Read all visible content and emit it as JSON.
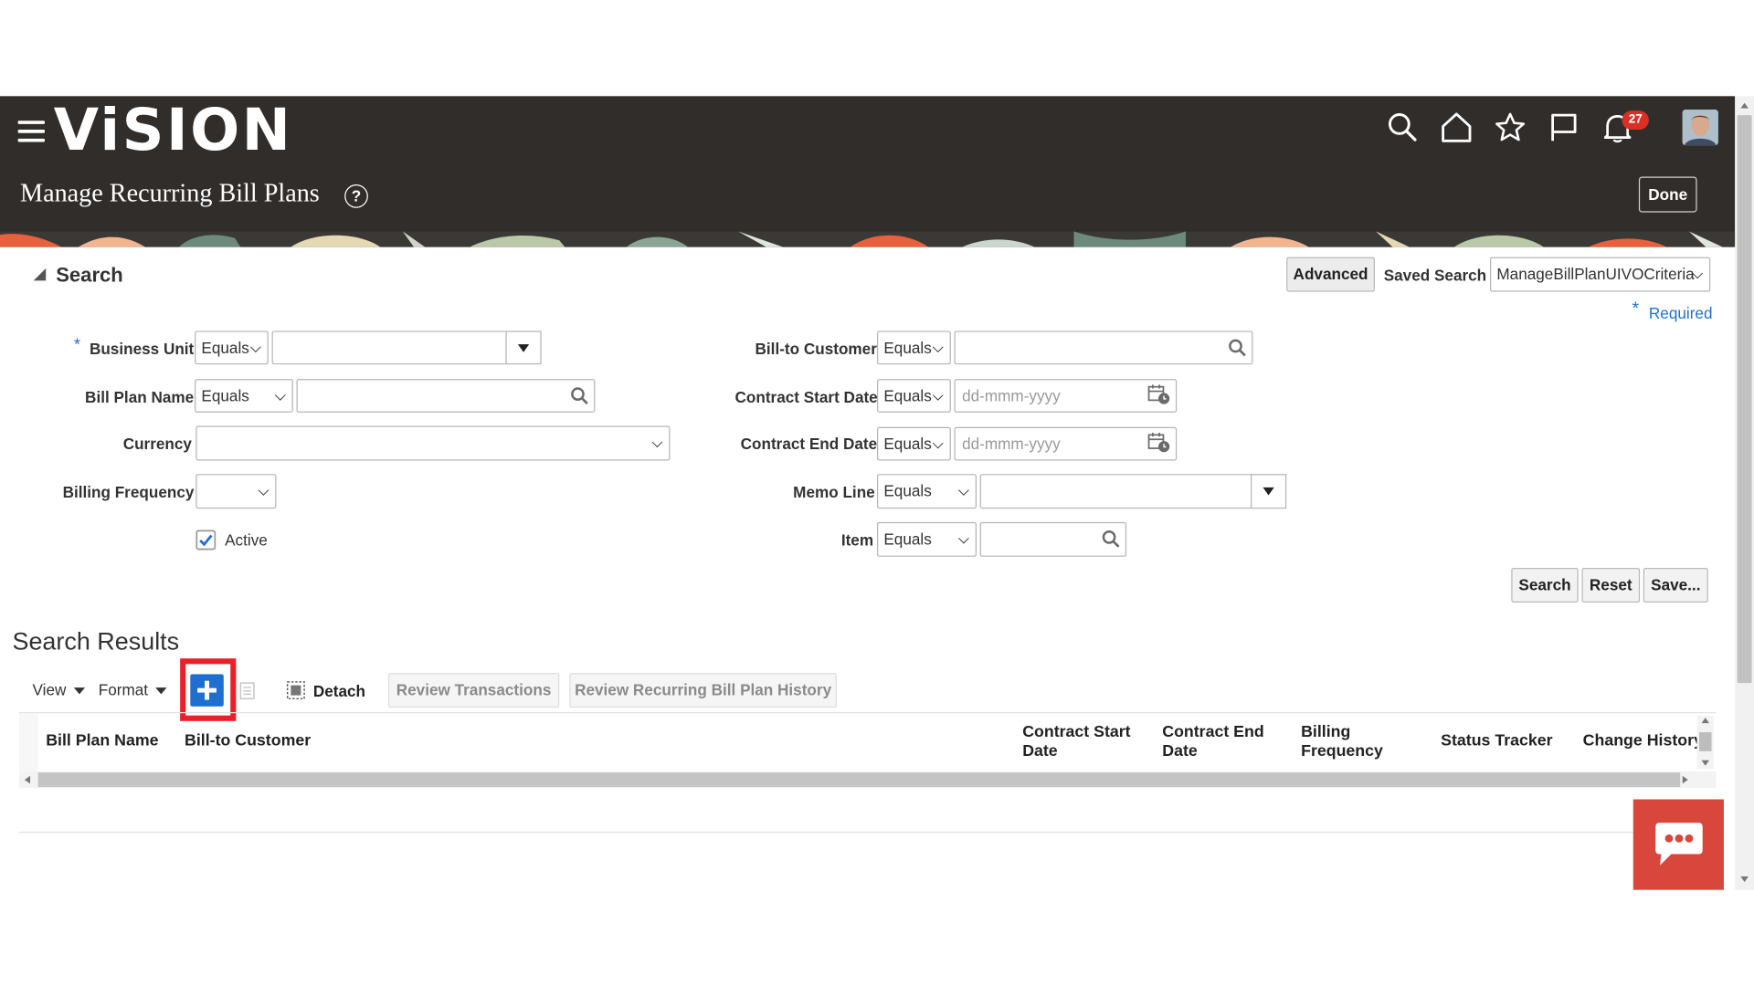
{
  "header": {
    "logo_text": "ViSION",
    "page_title": "Manage Recurring Bill Plans",
    "done_label": "Done",
    "notification_count": "27",
    "help_glyph": "?"
  },
  "search": {
    "section_title": "Search",
    "advanced_label": "Advanced",
    "saved_search_label": "Saved Search",
    "saved_search_value": "ManageBillPlanUIVOCriteria",
    "required_star": "*",
    "required_label": "Required",
    "fields": {
      "business_unit": {
        "label": "Business Unit",
        "operator": "Equals",
        "value": ""
      },
      "bill_plan_name": {
        "label": "Bill Plan Name",
        "operator": "Equals",
        "value": ""
      },
      "currency": {
        "label": "Currency",
        "value": ""
      },
      "billing_frequency": {
        "label": "Billing Frequency",
        "value": ""
      },
      "active": {
        "label": "Active",
        "checked": true
      },
      "bill_to_customer": {
        "label": "Bill-to Customer",
        "operator": "Equals",
        "value": ""
      },
      "contract_start_date": {
        "label": "Contract Start Date",
        "operator": "Equals",
        "placeholder": "dd-mmm-yyyy"
      },
      "contract_end_date": {
        "label": "Contract End Date",
        "operator": "Equals",
        "placeholder": "dd-mmm-yyyy"
      },
      "memo_line": {
        "label": "Memo Line",
        "operator": "Equals",
        "value": ""
      },
      "item": {
        "label": "Item",
        "operator": "Equals",
        "value": ""
      }
    },
    "buttons": {
      "search": "Search",
      "reset": "Reset",
      "save": "Save..."
    }
  },
  "results": {
    "title": "Search Results",
    "toolbar": {
      "view": "View",
      "format": "Format",
      "detach": "Detach",
      "review_transactions": "Review Transactions",
      "review_history": "Review Recurring Bill Plan History"
    },
    "columns": [
      "Bill Plan Name",
      "Bill-to Customer",
      "Contract Start Date",
      "Contract End Date",
      "Billing Frequency",
      "Status Tracker",
      "Change History"
    ],
    "rows": []
  },
  "colors": {
    "header_bg": "#312d2a",
    "highlight": "#e8202a",
    "add_button": "#1f6fd1",
    "chat_bg": "#d9473c"
  }
}
